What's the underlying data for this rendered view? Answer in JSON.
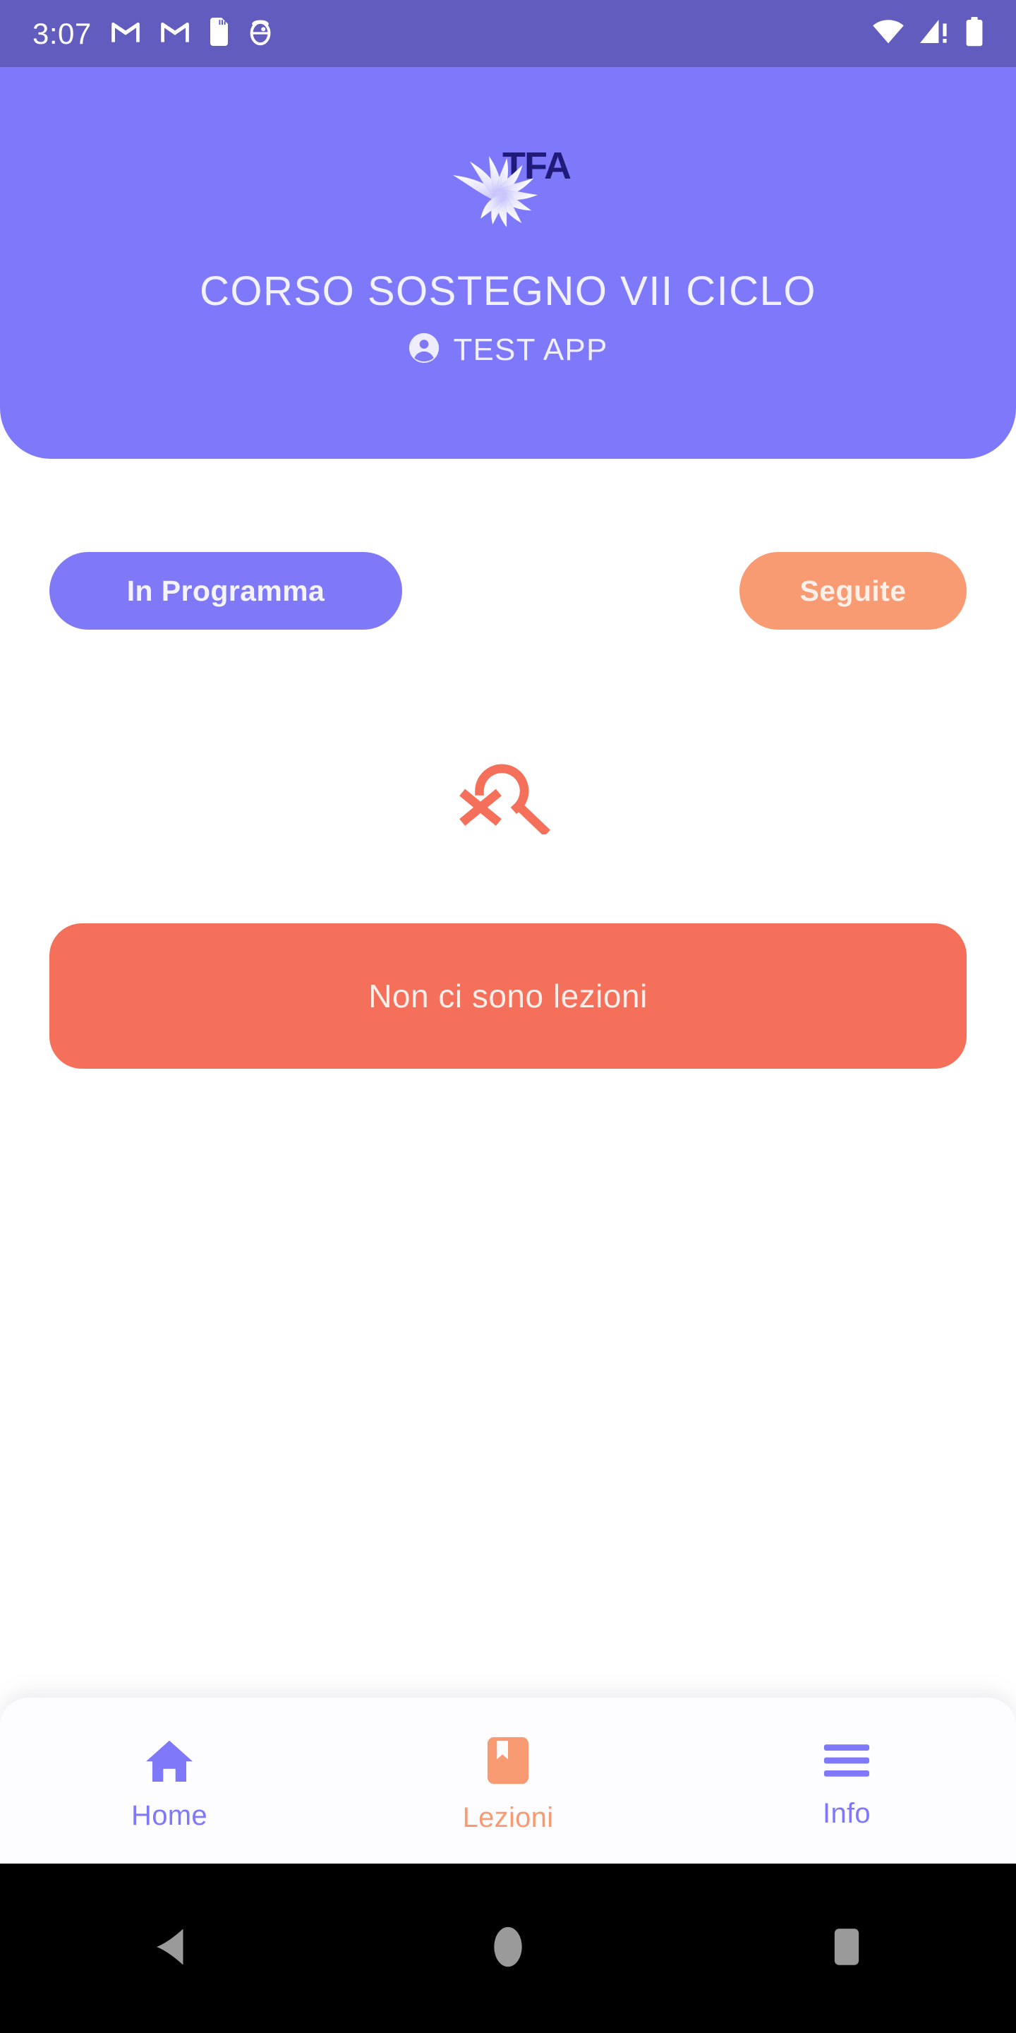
{
  "status_bar": {
    "time": "3:07",
    "left_icons": [
      "gmail-icon",
      "gmail-icon",
      "sd-card-icon",
      "android-debug-icon"
    ],
    "right_icons": [
      "wifi-icon",
      "cellular-signal-warning-icon",
      "battery-icon"
    ],
    "background_color": "#615cbe",
    "foreground_color": "#ffffff"
  },
  "header": {
    "logo_name": "tfa-sun-logo",
    "logo_text": "TFA",
    "title": "CORSO SOSTEGNO VII CICLO",
    "account_name": "TEST APP",
    "account_icon": "account-circle-icon",
    "background_color": "#7e79fb",
    "text_color": "#f2f1fe"
  },
  "filters": {
    "in_programma": {
      "label": "In Programma",
      "background_color": "#8079f7",
      "text_color": "#f4f3fe",
      "selected": true
    },
    "seguite": {
      "label": "Seguite",
      "background_color": "#f89a72",
      "text_color": "#fdf0e9",
      "selected": false
    }
  },
  "empty_state": {
    "icon": "search-off-icon",
    "icon_color": "#f4705b",
    "message": "Non ci sono lezioni",
    "banner_color": "#f4705b",
    "message_color": "#fdeeea"
  },
  "bottom_nav": {
    "items": [
      {
        "label": "Home",
        "icon": "home-icon",
        "color": "#7f79f9",
        "active": false
      },
      {
        "label": "Lezioni",
        "icon": "bookmark-book-icon",
        "color": "#f89a72",
        "active": true
      },
      {
        "label": "Info",
        "icon": "hamburger-menu-icon",
        "color": "#7f79f9",
        "active": false
      }
    ]
  },
  "android_nav": {
    "back": "back-triangle-icon",
    "home": "home-circle-icon",
    "recents": "recents-square-icon",
    "icon_color": "#9a9a9a",
    "background_color": "#000000"
  }
}
